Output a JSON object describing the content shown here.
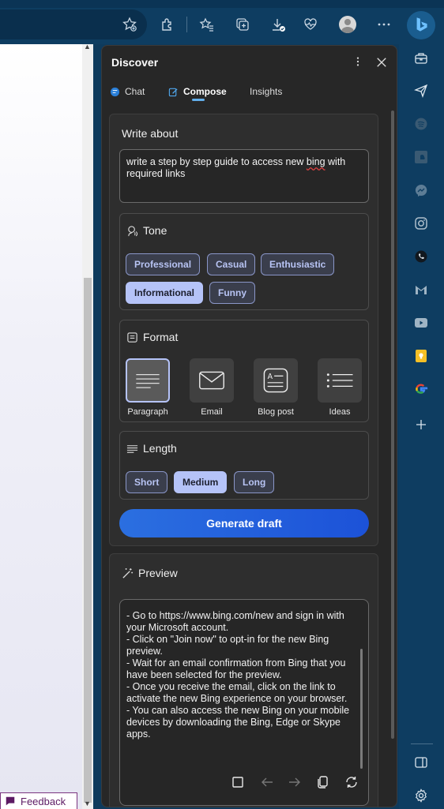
{
  "browser": {
    "toolbar_icons": [
      "favorite-add-icon",
      "extensions-icon",
      "favorites-icon",
      "collections-icon",
      "downloads-icon",
      "browser-essentials-icon",
      "profile-avatar",
      "more-icon",
      "bing-icon"
    ]
  },
  "page": {
    "feedback_label": "Feedback"
  },
  "panel": {
    "title": "Discover",
    "tabs": [
      {
        "label": "Chat",
        "icon": "chat-icon"
      },
      {
        "label": "Compose",
        "icon": "compose-icon",
        "active": true
      },
      {
        "label": "Insights"
      }
    ],
    "compose": {
      "write_about_label": "Write about",
      "write_about_value": "write a step by step guide to access new bing with required links",
      "write_about_parts": {
        "before": "write a step by step guide to access new ",
        "misspelled": "bing",
        "after": " with required links"
      },
      "tone": {
        "label": "Tone",
        "options": [
          {
            "label": "Professional",
            "selected": false
          },
          {
            "label": "Casual",
            "selected": false
          },
          {
            "label": "Enthusiastic",
            "selected": false
          },
          {
            "label": "Informational",
            "selected": true
          },
          {
            "label": "Funny",
            "selected": false
          }
        ]
      },
      "format": {
        "label": "Format",
        "options": [
          {
            "label": "Paragraph",
            "icon": "paragraph-icon",
            "selected": true
          },
          {
            "label": "Email",
            "icon": "email-icon",
            "selected": false
          },
          {
            "label": "Blog post",
            "icon": "blog-post-icon",
            "selected": false
          },
          {
            "label": "Ideas",
            "icon": "ideas-icon",
            "selected": false
          }
        ]
      },
      "length": {
        "label": "Length",
        "options": [
          {
            "label": "Short",
            "selected": false
          },
          {
            "label": "Medium",
            "selected": true
          },
          {
            "label": "Long",
            "selected": false
          }
        ]
      },
      "generate_label": "Generate draft"
    },
    "preview": {
      "label": "Preview",
      "lines": [
        "- Go to https://www.bing.com/new and sign in with your Microsoft account.",
        "- Click on \"Join now\" to opt-in for the new Bing preview.",
        "- Wait for an email confirmation from Bing that you have been selected for the preview.",
        "- Once you receive the email, click on the link to activate the new Bing experience on your browser.",
        "- You can also access the new Bing on your mobile devices by downloading the Bing, Edge or Skype apps."
      ],
      "actions": [
        "stop-icon",
        "previous-icon",
        "next-icon",
        "copy-icon",
        "regenerate-icon"
      ]
    }
  },
  "sidebar": {
    "icons": [
      "tools-icon",
      "send-icon",
      "spotify-icon",
      "soundcloud-icon",
      "messenger-icon",
      "instagram-icon",
      "whatsapp-icon",
      "gmail-icon",
      "youtube-icon",
      "keep-notes-icon",
      "google-icon",
      "add-icon",
      "split-panel-icon",
      "settings-icon"
    ]
  },
  "colors": {
    "browser_frame": "#0e3d61",
    "panel_bg": "#272727",
    "chip_selected": "#b5c3f8",
    "accent": "#62aeea",
    "generate_button": "#2b6fe0"
  }
}
